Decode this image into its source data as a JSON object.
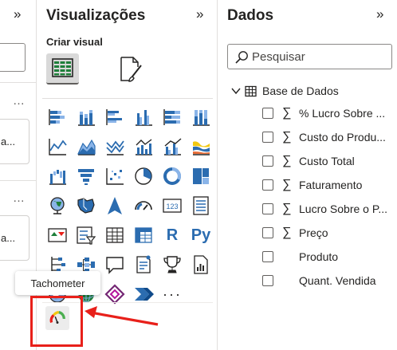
{
  "left_pane": {
    "collapse_glyph": "»",
    "more_glyph": "…",
    "card1_text": "a...",
    "card2_text": "a..."
  },
  "visualizations": {
    "title": "Visualizações",
    "collapse_glyph": "»",
    "subtitle": "Criar visual",
    "more_glyph": "···",
    "tooltip": "Tachometer",
    "text_icons": {
      "r": "R",
      "py": "Py"
    }
  },
  "data_pane": {
    "title": "Dados",
    "collapse_glyph": "»",
    "search_placeholder": "Pesquisar",
    "table_name": "Base de Dados",
    "sigma_glyph": "∑",
    "fields": [
      {
        "label": "% Lucro Sobre ...",
        "sigma": true
      },
      {
        "label": "Custo do Produ...",
        "sigma": true
      },
      {
        "label": "Custo Total",
        "sigma": true
      },
      {
        "label": "Faturamento",
        "sigma": true
      },
      {
        "label": "Lucro Sobre o P...",
        "sigma": true
      },
      {
        "label": "Preço",
        "sigma": true
      },
      {
        "label": "Produto",
        "sigma": false
      },
      {
        "label": "Quant. Vendida",
        "sigma": false
      }
    ]
  },
  "colors": {
    "accent_blue": "#2b6cb0",
    "highlight_red": "#e8201a",
    "text": "#252423"
  }
}
